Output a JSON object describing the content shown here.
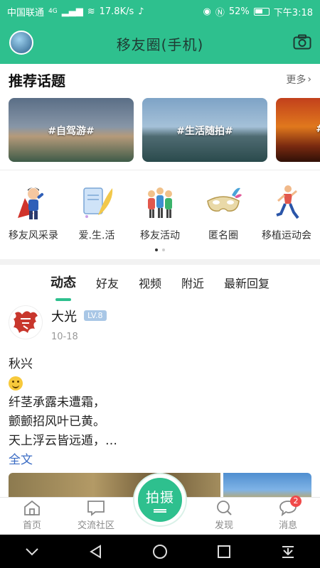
{
  "status_bar": {
    "carrier": "中国联通",
    "network": "4G",
    "speed": "17.8K/s",
    "battery": "52%",
    "time": "下午3:18"
  },
  "header": {
    "title": "移友圈(手机)"
  },
  "topics": {
    "heading": "推荐话题",
    "more": "更多",
    "cards": [
      {
        "label": "#自驾游#"
      },
      {
        "label": "#生活随拍#"
      },
      {
        "label": "#"
      }
    ]
  },
  "categories": [
    {
      "label": "移友风采录"
    },
    {
      "label": "爱.生.活"
    },
    {
      "label": "移友活动"
    },
    {
      "label": "匿名圈"
    },
    {
      "label": "移植运动会"
    }
  ],
  "feed_tabs": [
    "动态",
    "好友",
    "视频",
    "附近",
    "最新回复"
  ],
  "post": {
    "author": "大光",
    "level": "LV.8",
    "date": "10-18",
    "title": "秋兴",
    "lines": [
      "纤茎承露未遭霜，",
      "颤颤招风叶已黄。",
      "天上浮云皆远遁，…"
    ],
    "full_text": "全文"
  },
  "bottom_nav": {
    "home": "首页",
    "community": "交流社区",
    "shoot": "拍摄",
    "discover": "发现",
    "messages": "消息",
    "message_badge": "2"
  },
  "colors": {
    "brand": "#2ec08e",
    "link": "#3b6cc4",
    "badge": "#f04a4a"
  }
}
